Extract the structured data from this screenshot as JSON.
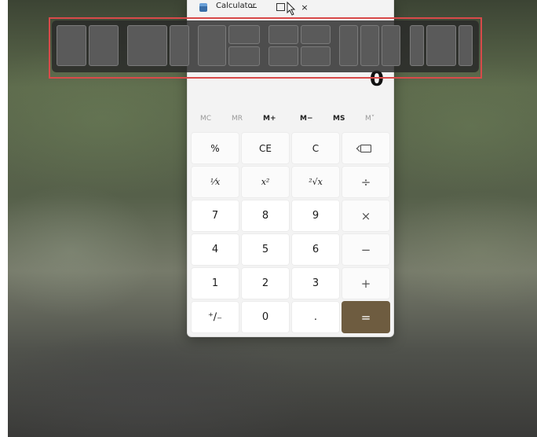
{
  "window": {
    "title": "Calculator",
    "buttons": {
      "minimize": "minimize-icon",
      "maximize": "maximize-icon",
      "close": "×"
    }
  },
  "display": {
    "value": "0"
  },
  "memory": [
    "MC",
    "MR",
    "M+",
    "M−",
    "MS",
    "M˅"
  ],
  "keypad": {
    "row1": [
      "%",
      "CE",
      "C",
      "⌫"
    ],
    "row2": [
      "¹⁄x",
      "x²",
      "²√x",
      "÷"
    ],
    "row3": [
      "7",
      "8",
      "9",
      "×"
    ],
    "row4": [
      "4",
      "5",
      "6",
      "−"
    ],
    "row5": [
      "1",
      "2",
      "3",
      "+"
    ],
    "row6": [
      "⁺∕₋",
      "0",
      ".",
      "="
    ]
  },
  "snap_layouts": {
    "count": 6,
    "icon": "snap-layouts-icon"
  },
  "colors": {
    "equals_button": "#6e5c40",
    "highlight_outline": "#d94a4a"
  }
}
